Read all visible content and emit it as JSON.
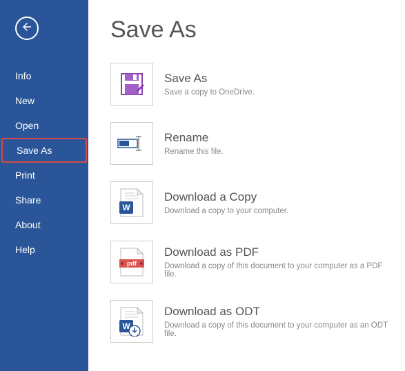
{
  "sidebar": {
    "items": [
      {
        "label": "Info"
      },
      {
        "label": "New"
      },
      {
        "label": "Open"
      },
      {
        "label": "Save As"
      },
      {
        "label": "Print"
      },
      {
        "label": "Share"
      },
      {
        "label": "About"
      },
      {
        "label": "Help"
      }
    ],
    "selectedIndex": 3
  },
  "page": {
    "title": "Save As"
  },
  "options": [
    {
      "title": "Save As",
      "desc": "Save a copy to OneDrive.",
      "icon": "save-icon"
    },
    {
      "title": "Rename",
      "desc": "Rename this file.",
      "icon": "rename-icon"
    },
    {
      "title": "Download a Copy",
      "desc": "Download a copy to your computer.",
      "icon": "word-doc-icon"
    },
    {
      "title": "Download as PDF",
      "desc": "Download a copy of this document to your computer as a PDF file.",
      "icon": "pdf-doc-icon"
    },
    {
      "title": "Download as ODT",
      "desc": "Download a copy of this document to your computer as an ODT file.",
      "icon": "odt-doc-icon"
    }
  ]
}
